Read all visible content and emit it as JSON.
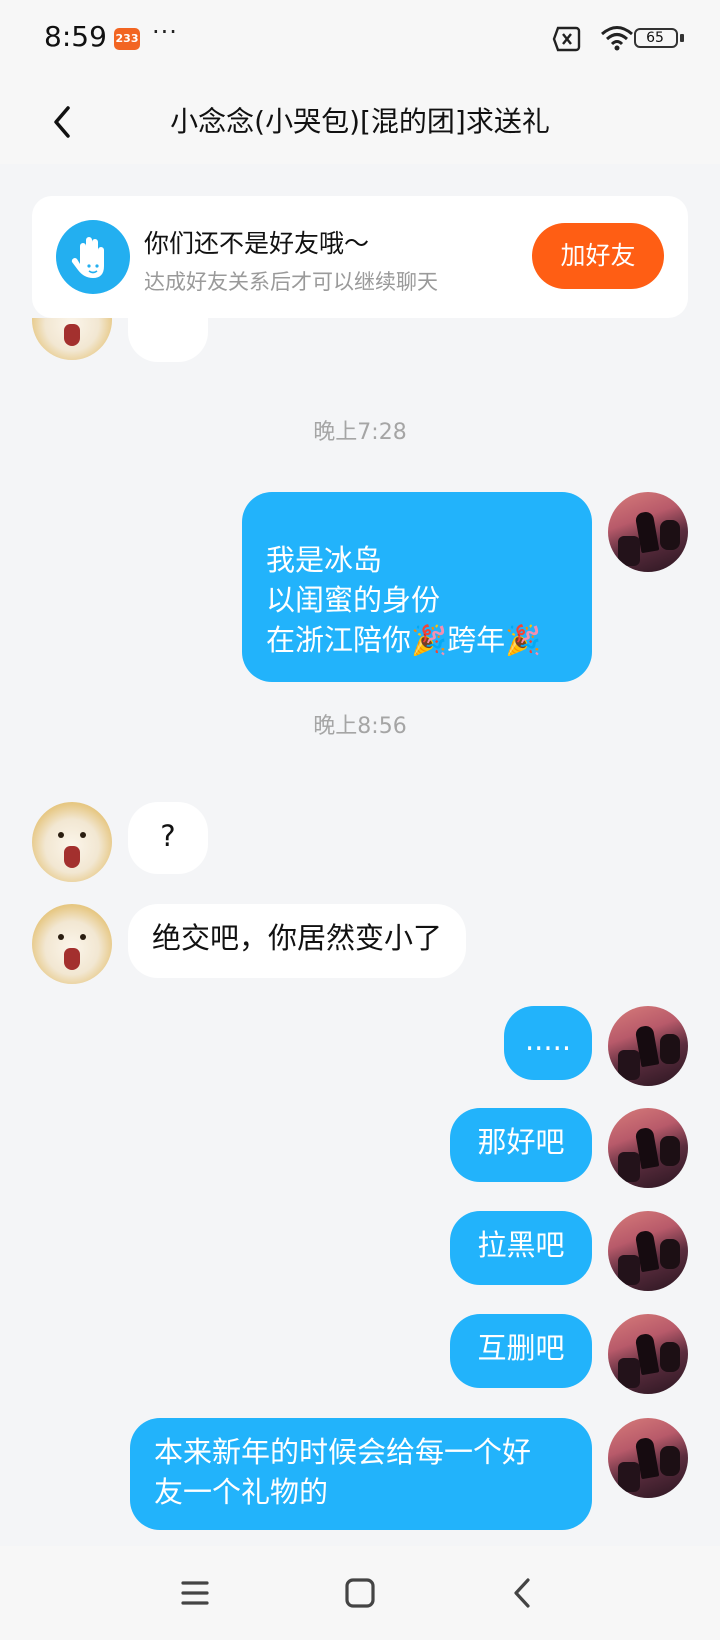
{
  "status_bar": {
    "time": "8:59",
    "badge": "233",
    "more": "···",
    "battery": "65"
  },
  "header": {
    "title": "小念念(小哭包)[混的团]求送礼"
  },
  "friend_banner": {
    "title": "你们还不是好友哦～",
    "subtitle": "达成好友关系后才可以继续聊天",
    "add_button": "加好友"
  },
  "messages": {
    "timestamp_1": "晚上7:28",
    "msg_1_lines": [
      "我是冰岛",
      "以闺蜜的身份",
      "在浙江陪你🎉跨年🎉"
    ],
    "timestamp_2": "晚上8:56",
    "msg_2": "?",
    "msg_3": "绝交吧，你居然变小了",
    "msg_4": ".....",
    "msg_5": "那好吧",
    "msg_6": "拉黑吧",
    "msg_7": "互删吧",
    "msg_8_lines": [
      "本来新年的时候会给每一个好",
      "友一个礼物的"
    ]
  },
  "colors": {
    "outgoing_bubble": "#22b3fb",
    "incoming_bubble": "#ffffff",
    "add_friend_button": "#ff5e14",
    "background": "#f4f5f7"
  },
  "icons": {
    "back": "chevron-left-icon",
    "banner": "wave-hand-icon",
    "nav_menu": "menu-icon",
    "nav_home": "home-square-icon",
    "nav_back": "back-triangle-icon"
  }
}
